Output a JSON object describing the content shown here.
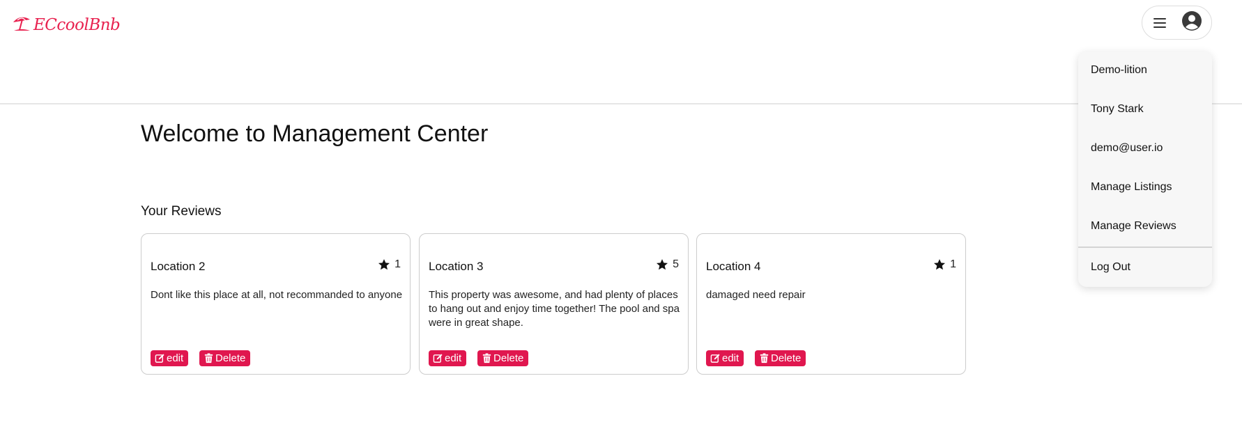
{
  "header": {
    "logo_text": "ECcoolBnb",
    "logo_icon": "beach-umbrella-icon",
    "menu_icon": "hamburger-icon",
    "avatar_icon": "user-circle-icon"
  },
  "dropdown": {
    "username": "Demo-lition",
    "full_name": "Tony Stark",
    "email": "demo@user.io",
    "manage_listings": "Manage Listings",
    "manage_reviews": "Manage Reviews",
    "logout": "Log Out"
  },
  "main": {
    "title": "Welcome to Management Center",
    "reviews_heading": "Your Reviews"
  },
  "reviews": [
    {
      "location": "Location 2",
      "stars": "1",
      "text": "Dont like this place at all, not recommanded to anyone",
      "edit_label": "edit",
      "delete_label": "Delete"
    },
    {
      "location": "Location 3",
      "stars": "5",
      "text": "This property was awesome, and had plenty of places to hang out and enjoy time together! The pool and spa were in great shape.",
      "edit_label": "edit",
      "delete_label": "Delete"
    },
    {
      "location": "Location 4",
      "stars": "1",
      "text": "damaged need repair",
      "edit_label": "edit",
      "delete_label": "Delete"
    }
  ],
  "colors": {
    "brand": "#e8214f",
    "button": "#e0174f"
  }
}
